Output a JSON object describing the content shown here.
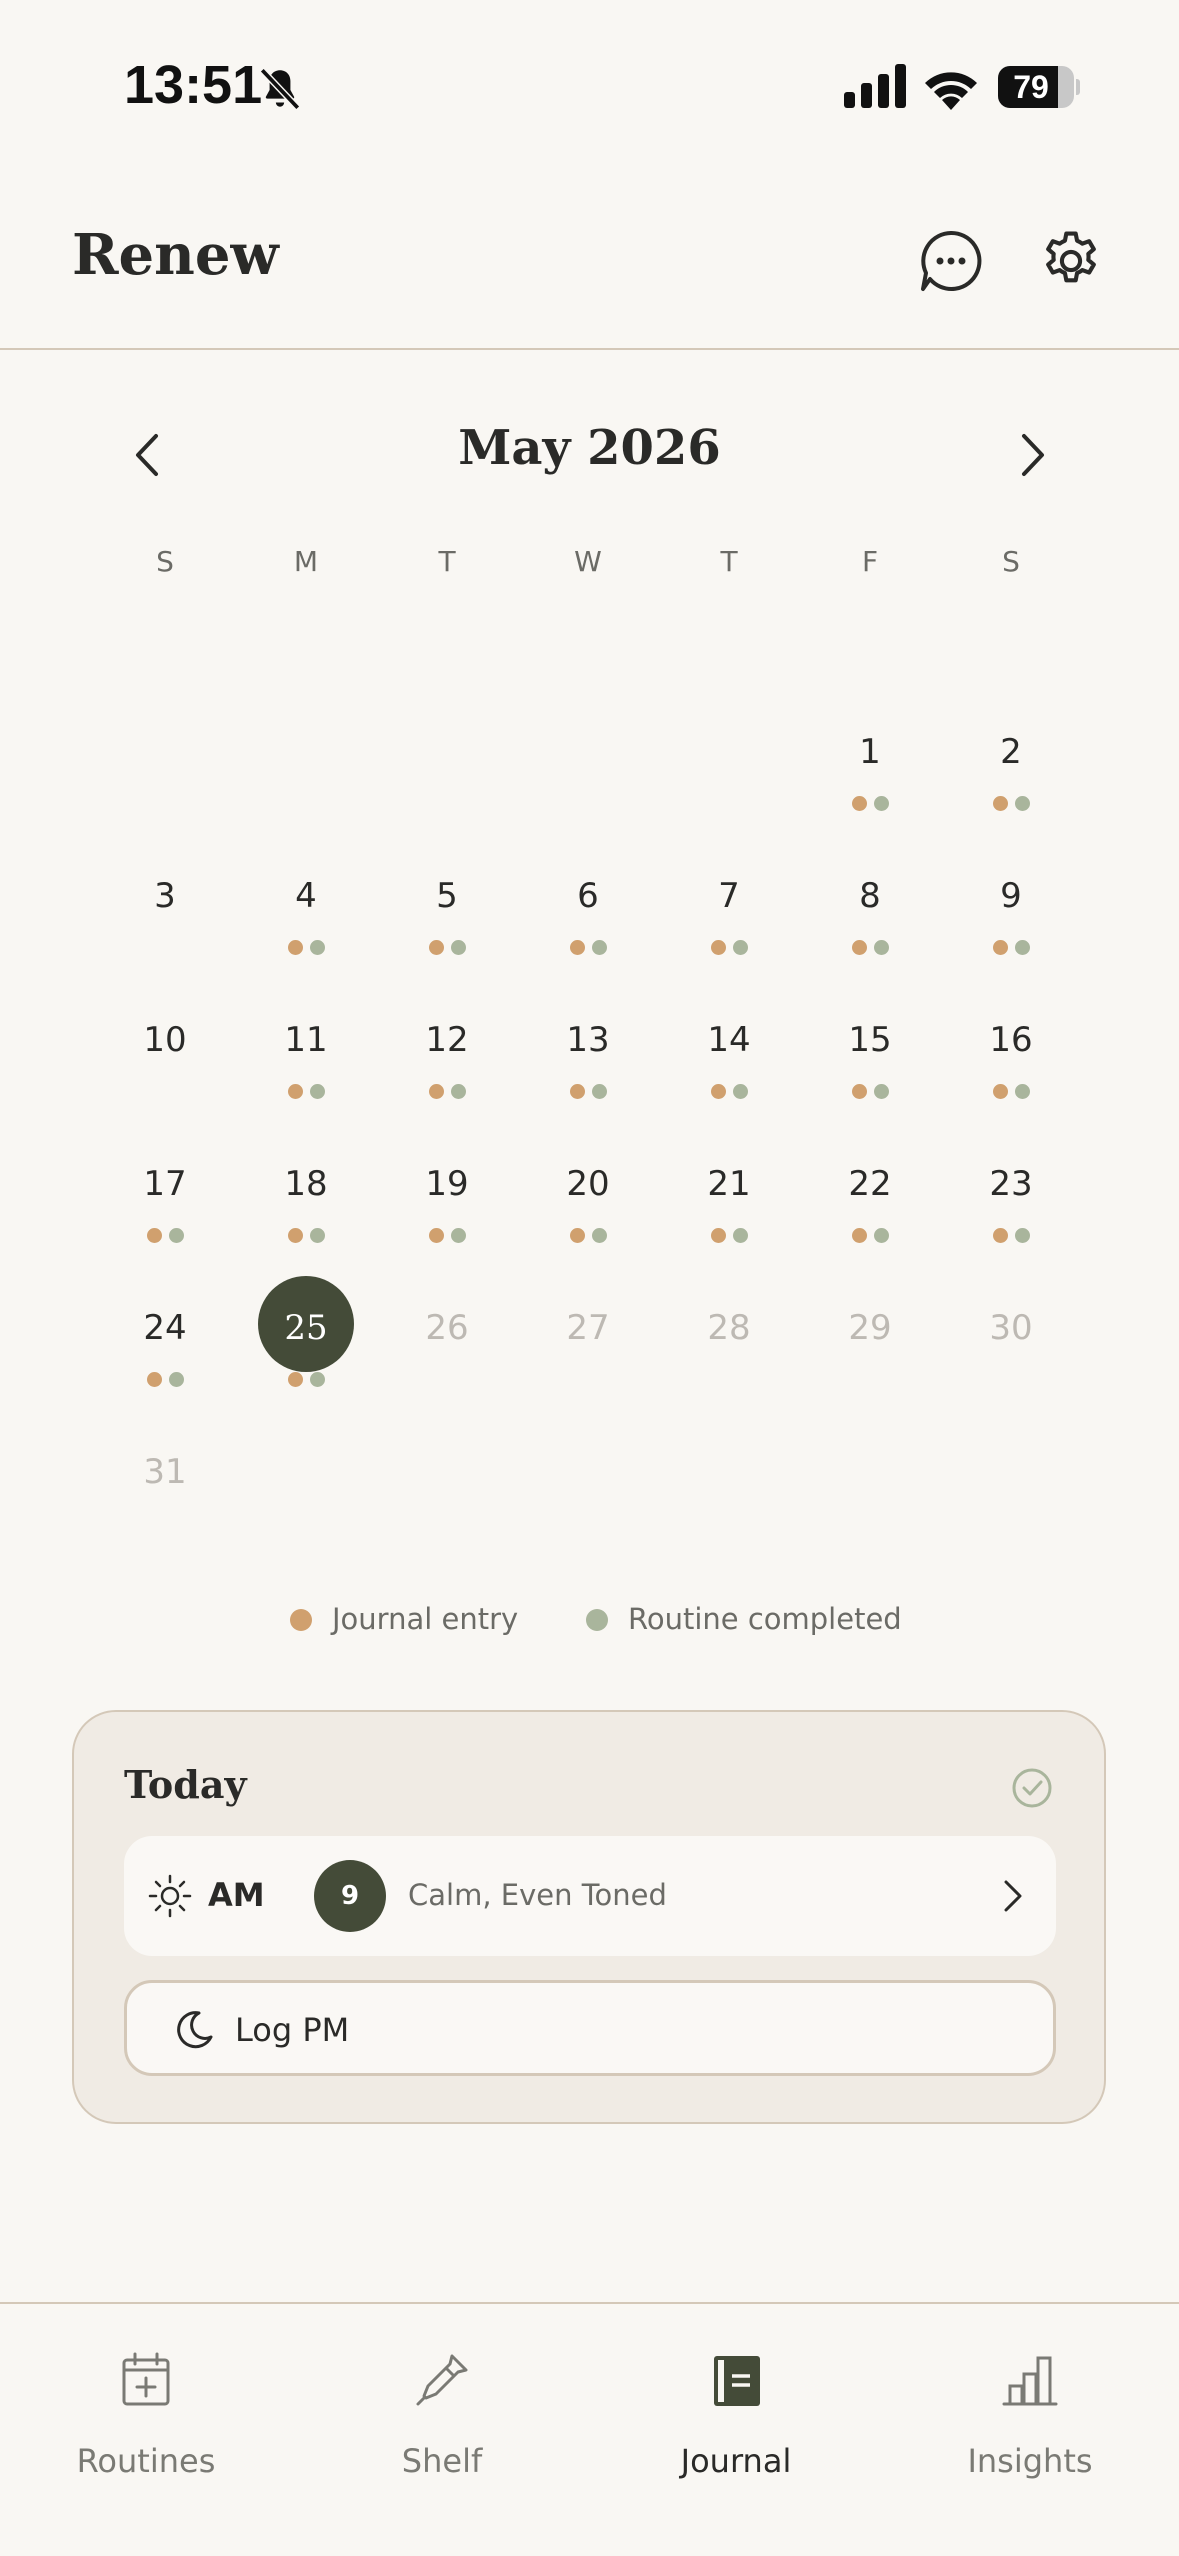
{
  "status_bar": {
    "time": "13:51",
    "battery": "79",
    "battery_level": 0.79
  },
  "header": {
    "title": "Renew"
  },
  "calendar": {
    "month_label": "May 2026",
    "weekdays": [
      "S",
      "M",
      "T",
      "W",
      "T",
      "F",
      "S"
    ],
    "days": [
      {
        "day": "1",
        "journal": true,
        "routine": true,
        "state": "past"
      },
      {
        "day": "2",
        "journal": true,
        "routine": true,
        "state": "past"
      },
      {
        "day": "3",
        "journal": false,
        "routine": false,
        "state": "past"
      },
      {
        "day": "4",
        "journal": true,
        "routine": true,
        "state": "past"
      },
      {
        "day": "5",
        "journal": true,
        "routine": true,
        "state": "past"
      },
      {
        "day": "6",
        "journal": true,
        "routine": true,
        "state": "past"
      },
      {
        "day": "7",
        "journal": true,
        "routine": true,
        "state": "past"
      },
      {
        "day": "8",
        "journal": true,
        "routine": true,
        "state": "past"
      },
      {
        "day": "9",
        "journal": true,
        "routine": true,
        "state": "past"
      },
      {
        "day": "10",
        "journal": false,
        "routine": false,
        "state": "past"
      },
      {
        "day": "11",
        "journal": true,
        "routine": true,
        "state": "past"
      },
      {
        "day": "12",
        "journal": true,
        "routine": true,
        "state": "past"
      },
      {
        "day": "13",
        "journal": true,
        "routine": true,
        "state": "past"
      },
      {
        "day": "14",
        "journal": true,
        "routine": true,
        "state": "past"
      },
      {
        "day": "15",
        "journal": true,
        "routine": true,
        "state": "past"
      },
      {
        "day": "16",
        "journal": true,
        "routine": true,
        "state": "past"
      },
      {
        "day": "17",
        "journal": true,
        "routine": true,
        "state": "past"
      },
      {
        "day": "18",
        "journal": true,
        "routine": true,
        "state": "past"
      },
      {
        "day": "19",
        "journal": true,
        "routine": true,
        "state": "past"
      },
      {
        "day": "20",
        "journal": true,
        "routine": true,
        "state": "past"
      },
      {
        "day": "21",
        "journal": true,
        "routine": true,
        "state": "past"
      },
      {
        "day": "22",
        "journal": true,
        "routine": true,
        "state": "past"
      },
      {
        "day": "23",
        "journal": true,
        "routine": true,
        "state": "past"
      },
      {
        "day": "24",
        "journal": true,
        "routine": true,
        "state": "past"
      },
      {
        "day": "25",
        "journal": true,
        "routine": true,
        "state": "today"
      },
      {
        "day": "26",
        "journal": false,
        "routine": false,
        "state": "future"
      },
      {
        "day": "27",
        "journal": false,
        "routine": false,
        "state": "future"
      },
      {
        "day": "28",
        "journal": false,
        "routine": false,
        "state": "future"
      },
      {
        "day": "29",
        "journal": false,
        "routine": false,
        "state": "future"
      },
      {
        "day": "30",
        "journal": false,
        "routine": false,
        "state": "future"
      },
      {
        "day": "31",
        "journal": false,
        "routine": false,
        "state": "future"
      }
    ],
    "first_weekday": 5
  },
  "legend": {
    "journal_label": "Journal entry",
    "routine_label": "Routine completed"
  },
  "colors": {
    "journal": "#d0a06e",
    "routine": "#a9b59c",
    "accent": "#444b38"
  },
  "today_card": {
    "title": "Today",
    "am_label": "AM",
    "am_score": "9",
    "am_description": "Calm, Even Toned",
    "log_pm_label": "Log PM"
  },
  "tabs": [
    {
      "label": "Routines",
      "icon": "calendar-plus-icon",
      "active": false
    },
    {
      "label": "Shelf",
      "icon": "dropper-icon",
      "active": false
    },
    {
      "label": "Journal",
      "icon": "journal-icon",
      "active": true
    },
    {
      "label": "Insights",
      "icon": "bar-chart-icon",
      "active": false
    }
  ]
}
